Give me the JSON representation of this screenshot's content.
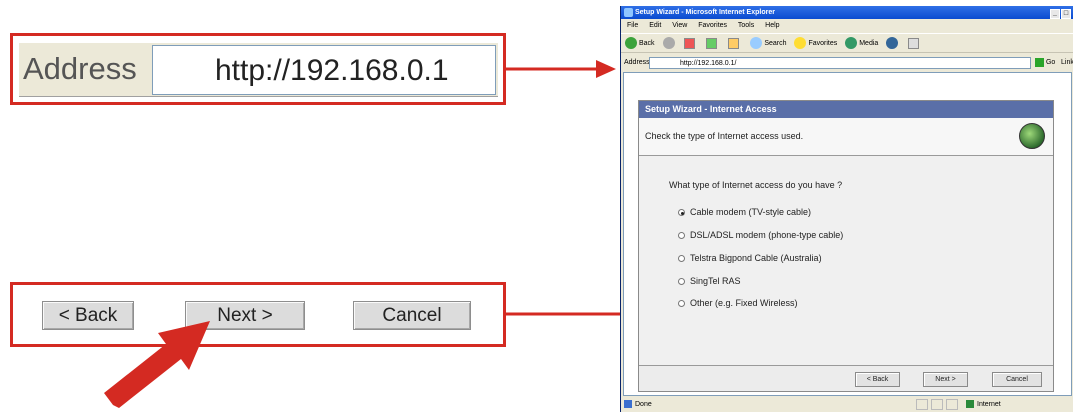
{
  "callout_address": {
    "label": "Address",
    "url": "http://192.168.0.1"
  },
  "callout_buttons": {
    "back": "< Back",
    "next": "Next >",
    "cancel": "Cancel"
  },
  "colors": {
    "callout_red": "#d42a22",
    "title_blue": "#0a4bd0",
    "wizard_title": "#5a6fa8"
  },
  "ie": {
    "title": "Setup Wizard - Microsoft Internet Explorer",
    "menu": [
      "File",
      "Edit",
      "View",
      "Favorites",
      "Tools",
      "Help"
    ],
    "toolbar": {
      "back": "Back",
      "search": "Search",
      "favorites": "Favorites",
      "media": "Media"
    },
    "address_label": "Address",
    "address_value": "http://192.168.0.1/",
    "go": "Go",
    "links": "Links",
    "status_left": "Done",
    "status_zone": "Internet"
  },
  "wizard": {
    "title": "Setup Wizard - Internet Access",
    "header": "Check the type of Internet access used.",
    "question": "What type of Internet access do you have ?",
    "options": [
      {
        "label": "Cable modem (TV-style cable)",
        "selected": true
      },
      {
        "label": "DSL/ADSL modem (phone-type cable)",
        "selected": false
      },
      {
        "label": "Telstra Bigpond Cable (Australia)",
        "selected": false
      },
      {
        "label": "SingTel RAS",
        "selected": false
      },
      {
        "label": "Other (e.g. Fixed Wireless)",
        "selected": false
      }
    ],
    "buttons": {
      "back": "< Back",
      "next": "Next >",
      "cancel": "Cancel"
    }
  }
}
